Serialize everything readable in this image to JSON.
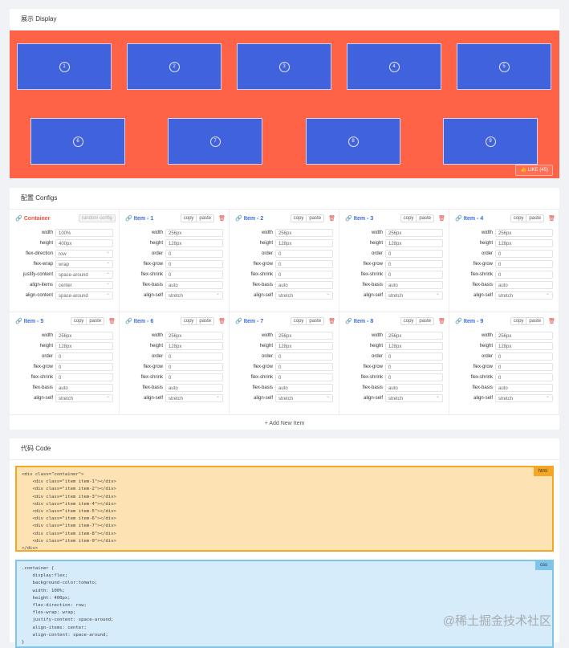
{
  "display": {
    "title": "展示 Display",
    "items": [
      "1",
      "2",
      "3",
      "4",
      "5",
      "6",
      "7",
      "8",
      "9"
    ],
    "like": "LIKE (45)",
    "colors": {
      "container": "#ff6347",
      "item": "#4062dc"
    }
  },
  "configs": {
    "title": "配置 Configs",
    "container": {
      "title": "Container",
      "random": "random config",
      "props": [
        {
          "label": "width",
          "value": "100%",
          "select": false
        },
        {
          "label": "height",
          "value": "400px",
          "select": false
        },
        {
          "label": "flex-direction",
          "value": "row",
          "select": true
        },
        {
          "label": "flex-wrap",
          "value": "wrap",
          "select": true
        },
        {
          "label": "justify-content",
          "value": "space-around",
          "select": true
        },
        {
          "label": "align-items",
          "value": "center",
          "select": true
        },
        {
          "label": "align-content",
          "value": "space-around",
          "select": true
        }
      ]
    },
    "copy": "copy",
    "paste": "paste",
    "items": [
      {
        "title": "Item - 1"
      },
      {
        "title": "Item - 2"
      },
      {
        "title": "Item - 3"
      },
      {
        "title": "Item - 4"
      },
      {
        "title": "Item - 5"
      },
      {
        "title": "Item - 6"
      },
      {
        "title": "Item - 7"
      },
      {
        "title": "Item - 8"
      },
      {
        "title": "Item - 9"
      }
    ],
    "item_props": [
      {
        "label": "width",
        "value": "256px",
        "select": false
      },
      {
        "label": "height",
        "value": "128px",
        "select": false
      },
      {
        "label": "order",
        "value": "0",
        "select": false
      },
      {
        "label": "flex-grow",
        "value": "0",
        "select": false
      },
      {
        "label": "flex-shrink",
        "value": "0",
        "select": false
      },
      {
        "label": "flex-basis",
        "value": "auto",
        "select": false
      },
      {
        "label": "align-self",
        "value": "stretch",
        "select": true
      }
    ],
    "add_item": "+ Add New Item"
  },
  "code": {
    "title": "代码 Code",
    "html_tag": "html",
    "css_tag": "css",
    "html": "<div class=\"container\">\n    <div class=\"item item-1\"></div>\n    <div class=\"item item-2\"></div>\n    <div class=\"item item-3\"></div>\n    <div class=\"item item-4\"></div>\n    <div class=\"item item-5\"></div>\n    <div class=\"item item-6\"></div>\n    <div class=\"item item-7\"></div>\n    <div class=\"item item-8\"></div>\n    <div class=\"item item-9\"></div>\n</div>",
    "css": ".container {\n    display:flex;\n    background-color:tomato;\n    width: 100%;\n    height: 400px;\n    flex-direction: row;\n    flex-wrap: wrap;\n    justify-content: space-around;\n    align-items: center;\n    align-content: space-around;\n}"
  },
  "watermark": "@稀土掘金技术社区"
}
